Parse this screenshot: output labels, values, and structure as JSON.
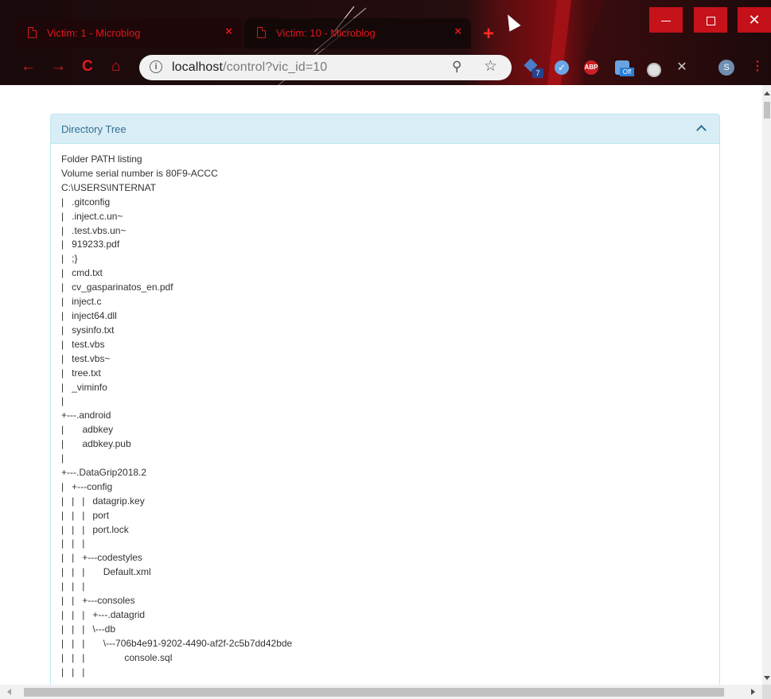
{
  "browser": {
    "tabs": [
      {
        "title": "Victim: 1 - Microblog",
        "close": "×"
      },
      {
        "title": "Victim: 10 - Microblog",
        "close": "×"
      }
    ],
    "new_tab": "+",
    "nav": {
      "back": "←",
      "forward": "→",
      "reload": "C",
      "home": "⌂"
    },
    "url_host": "localhost",
    "url_rest": "/control?vic_id=10",
    "info_icon": "i",
    "zoom_icon": "⚲",
    "star_icon": "☆",
    "extensions": {
      "badge_count": "7",
      "abp_label": "ABP",
      "off_label": "Off",
      "avatar_letter": "S"
    },
    "menu": "⋮",
    "window_controls": {
      "close": "✕"
    }
  },
  "panel": {
    "title": "Directory Tree",
    "lines": [
      "Folder PATH listing",
      "Volume serial number is 80F9-ACCC",
      "C:\\USERS\\INTERNAT",
      "|   .gitconfig",
      "|   .inject.c.un~",
      "|   .test.vbs.un~",
      "|   919233.pdf",
      "|   ;}",
      "|   cmd.txt",
      "|   cv_gasparinatos_en.pdf",
      "|   inject.c",
      "|   inject64.dll",
      "|   sysinfo.txt",
      "|   test.vbs",
      "|   test.vbs~",
      "|   tree.txt",
      "|   _viminfo",
      "|",
      "+---.android",
      "|       adbkey",
      "|       adbkey.pub",
      "|",
      "+---.DataGrip2018.2",
      "|   +---config",
      "|   |   |   datagrip.key",
      "|   |   |   port",
      "|   |   |   port.lock",
      "|   |   |",
      "|   |   +---codestyles",
      "|   |   |       Default.xml",
      "|   |   |",
      "|   |   +---consoles",
      "|   |   |   +---.datagrid",
      "|   |   |   \\---db",
      "|   |   |       \\---706b4e91-9202-4490-af2f-2c5b7dd42bde",
      "|   |   |               console.sql",
      "|   |   |"
    ]
  },
  "colors": {
    "accent_red": "#e0151b",
    "panel_heading_bg": "#d9edf7",
    "panel_border": "#bce8f1",
    "panel_title": "#31708f"
  }
}
